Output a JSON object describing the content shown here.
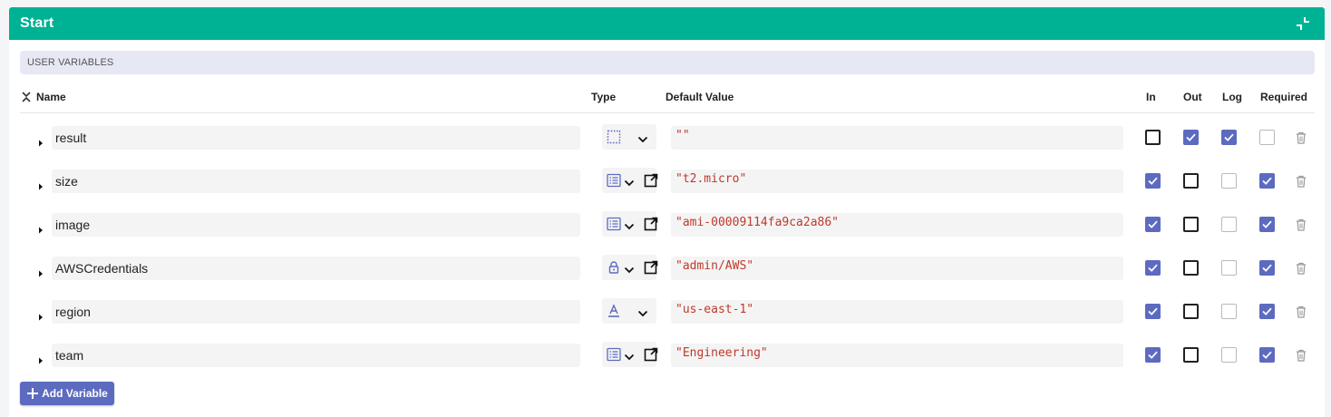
{
  "panel": {
    "title": "Start",
    "collapse_icon": "collapse-icon"
  },
  "section": {
    "label": "USER VARIABLES"
  },
  "columns": {
    "name": "Name",
    "type": "Type",
    "default_value": "Default Value",
    "in": "In",
    "out": "Out",
    "log": "Log",
    "required": "Required"
  },
  "variables": [
    {
      "name": "result",
      "type_icon": "empty-type-icon",
      "has_link": false,
      "default_value": "\"\"",
      "in": false,
      "out": true,
      "log": true,
      "required": false,
      "log_state": "checked",
      "required_state": "disabled"
    },
    {
      "name": "size",
      "type_icon": "list-icon",
      "has_link": true,
      "default_value": "\"t2.micro\"",
      "in": true,
      "out": false,
      "log": false,
      "required": true,
      "log_state": "disabled",
      "required_state": "checked"
    },
    {
      "name": "image",
      "type_icon": "list-icon",
      "has_link": true,
      "default_value": "\"ami-00009114fa9ca2a86\"",
      "in": true,
      "out": false,
      "log": false,
      "required": true,
      "log_state": "disabled",
      "required_state": "checked"
    },
    {
      "name": "AWSCredentials",
      "type_icon": "lock-icon",
      "has_link": true,
      "default_value": "\"admin/AWS\"",
      "in": true,
      "out": false,
      "log": false,
      "required": true,
      "log_state": "disabled",
      "required_state": "checked"
    },
    {
      "name": "region",
      "type_icon": "text-type-icon",
      "has_link": false,
      "default_value": "\"us-east-1\"",
      "in": true,
      "out": false,
      "log": false,
      "required": true,
      "log_state": "disabled",
      "required_state": "checked"
    },
    {
      "name": "team",
      "type_icon": "list-icon",
      "has_link": true,
      "default_value": "\"Engineering\"",
      "in": true,
      "out": false,
      "log": false,
      "required": true,
      "log_state": "disabled",
      "required_state": "checked"
    }
  ],
  "add_button": {
    "label": "Add Variable"
  },
  "colors": {
    "header": "#00b294",
    "accent": "#5c6bc0",
    "value_text": "#c0392b",
    "section_bar": "#e6e8f4"
  }
}
